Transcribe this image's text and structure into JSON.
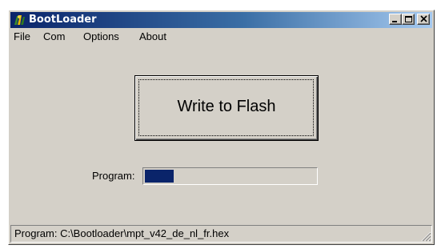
{
  "window": {
    "title": "BootLoader",
    "icon": "bootloader-app-icon",
    "controls": {
      "minimize_icon": "minimize-icon",
      "maximize_icon": "maximize-icon",
      "close_icon": "close-icon"
    }
  },
  "menu": {
    "items": [
      {
        "label": "File"
      },
      {
        "label": "Com"
      },
      {
        "label": "Options"
      },
      {
        "label": "About"
      }
    ]
  },
  "main": {
    "write_button_label": "Write to Flash",
    "program_label": "Program:",
    "progress_fraction": 0.17
  },
  "status": {
    "text": "Program: C:\\Bootloader\\mpt_v42_de_nl_fr.hex"
  },
  "colors": {
    "title_gradient_start": "#0a246a",
    "title_gradient_end": "#a6caf0",
    "progress_fill": "#0a246a",
    "window_face": "#d4d0c8"
  }
}
